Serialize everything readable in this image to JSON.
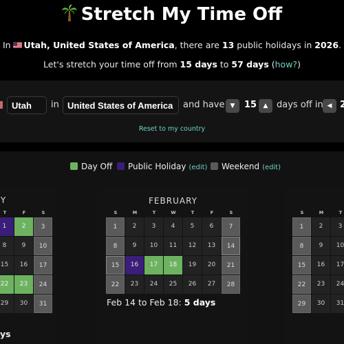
{
  "header": {
    "title": "Stretch My Time Off",
    "title_icon": "palm-tree-icon",
    "summary": {
      "prefix": "In",
      "flag_icon": "us-flag-icon",
      "location": "Utah, United States of America",
      "mid": ", there are",
      "holiday_count": "13",
      "mid2": "public holidays in",
      "year": "2026",
      "suffix": "."
    },
    "stretch": {
      "prefix": "Let's stretch your time off from",
      "from": "15 days",
      "mid": "to",
      "to": "57 days",
      "how_link": "how?"
    }
  },
  "controls": {
    "flag_icon": "us-flag-icon",
    "state_value": "Utah",
    "in_label": "in",
    "country_value": "United States of America",
    "and_have_label": "and have",
    "days_value": "15",
    "days_off_in_label": "days off in",
    "year_value_partial": "2",
    "reset_link": "Reset to my country"
  },
  "legend": {
    "day_off": {
      "label": "Day Off",
      "color": "#6db35f"
    },
    "public_holiday": {
      "label": "Public Holiday",
      "edit": "(edit)",
      "color": "#3b1d7a"
    },
    "weekend": {
      "label": "Weekend",
      "edit": "(edit)",
      "color": "#5a5a5a"
    }
  },
  "calendars": {
    "january": {
      "title_partial": "Y",
      "dow": [
        "T",
        "F",
        "S"
      ],
      "rows": [
        [
          {
            "d": "1",
            "t": "hol"
          },
          {
            "d": "2",
            "t": "off"
          },
          {
            "d": "3",
            "t": "we"
          }
        ],
        [
          {
            "d": "8",
            "t": ""
          },
          {
            "d": "9",
            "t": ""
          },
          {
            "d": "10",
            "t": "we"
          }
        ],
        [
          {
            "d": "15",
            "t": ""
          },
          {
            "d": "16",
            "t": ""
          },
          {
            "d": "17",
            "t": "we"
          }
        ],
        [
          {
            "d": "22",
            "t": "off"
          },
          {
            "d": "23",
            "t": "off"
          },
          {
            "d": "24",
            "t": "we"
          }
        ],
        [
          {
            "d": "29",
            "t": ""
          },
          {
            "d": "30",
            "t": ""
          },
          {
            "d": "31",
            "t": "we"
          }
        ]
      ],
      "summary_partial": "ys"
    },
    "february": {
      "title": "FEBRUARY",
      "dow": [
        "S",
        "M",
        "T",
        "W",
        "T",
        "F",
        "S"
      ],
      "rows": [
        [
          {
            "d": "1",
            "t": "we"
          },
          {
            "d": "2",
            "t": ""
          },
          {
            "d": "3",
            "t": ""
          },
          {
            "d": "4",
            "t": ""
          },
          {
            "d": "5",
            "t": ""
          },
          {
            "d": "6",
            "t": ""
          },
          {
            "d": "7",
            "t": "we"
          }
        ],
        [
          {
            "d": "8",
            "t": "we"
          },
          {
            "d": "9",
            "t": ""
          },
          {
            "d": "10",
            "t": ""
          },
          {
            "d": "11",
            "t": ""
          },
          {
            "d": "12",
            "t": ""
          },
          {
            "d": "13",
            "t": ""
          },
          {
            "d": "14",
            "t": "we hl"
          }
        ],
        [
          {
            "d": "15",
            "t": "we hl"
          },
          {
            "d": "16",
            "t": "hol"
          },
          {
            "d": "17",
            "t": "off"
          },
          {
            "d": "18",
            "t": "off"
          },
          {
            "d": "19",
            "t": ""
          },
          {
            "d": "20",
            "t": ""
          },
          {
            "d": "21",
            "t": "we"
          }
        ],
        [
          {
            "d": "22",
            "t": "we"
          },
          {
            "d": "23",
            "t": ""
          },
          {
            "d": "24",
            "t": ""
          },
          {
            "d": "25",
            "t": ""
          },
          {
            "d": "26",
            "t": ""
          },
          {
            "d": "27",
            "t": ""
          },
          {
            "d": "28",
            "t": "we"
          }
        ]
      ],
      "summary_range": "Feb 14 to Feb 18:",
      "summary_days": "5 days"
    },
    "march": {
      "dow": [
        "S",
        "M",
        "T"
      ],
      "rows": [
        [
          {
            "d": "1",
            "t": "we"
          },
          {
            "d": "2",
            "t": ""
          },
          {
            "d": "3",
            "t": ""
          }
        ],
        [
          {
            "d": "8",
            "t": "we"
          },
          {
            "d": "9",
            "t": ""
          },
          {
            "d": "10",
            "t": ""
          }
        ],
        [
          {
            "d": "15",
            "t": "we"
          },
          {
            "d": "16",
            "t": ""
          },
          {
            "d": "17",
            "t": ""
          }
        ],
        [
          {
            "d": "22",
            "t": "we"
          },
          {
            "d": "23",
            "t": ""
          },
          {
            "d": "24",
            "t": ""
          }
        ],
        [
          {
            "d": "29",
            "t": "we"
          },
          {
            "d": "30",
            "t": ""
          },
          {
            "d": "31",
            "t": ""
          }
        ]
      ]
    }
  }
}
